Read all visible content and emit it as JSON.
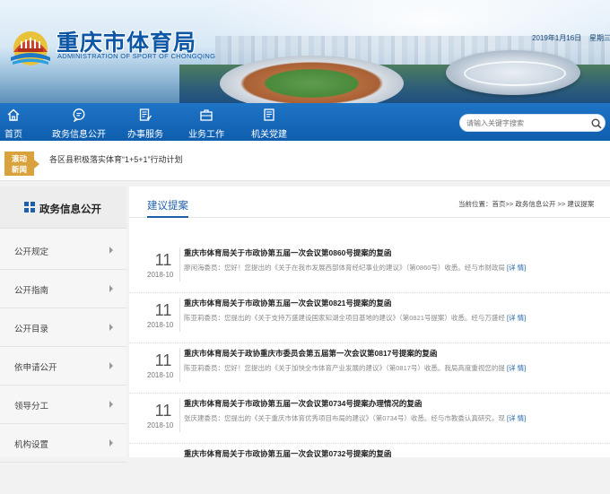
{
  "header": {
    "title": "重庆市体育局",
    "subtitle": "ADMINISTRATION OF SPORT OF CHONGQING",
    "date": "2019年1月16日",
    "weekday": "星期三"
  },
  "nav": {
    "items": [
      {
        "label": "首页",
        "icon": "home-icon"
      },
      {
        "label": "政务信息公开",
        "icon": "chat-bubble-icon"
      },
      {
        "label": "办事服务",
        "icon": "checklist-icon"
      },
      {
        "label": "业务工作",
        "icon": "briefcase-icon"
      },
      {
        "label": "机关党建",
        "icon": "document-icon"
      }
    ],
    "search_placeholder": "请输入关键字搜索"
  },
  "ticker": {
    "badge_line1": "滚动",
    "badge_line2": "新闻",
    "text": "各区县积极落实体育“1+5+1”行动计划"
  },
  "sidebar": {
    "title": "政务信息公开",
    "items": [
      {
        "label": "公开规定"
      },
      {
        "label": "公开指南"
      },
      {
        "label": "公开目录"
      },
      {
        "label": "依申请公开"
      },
      {
        "label": "领导分工"
      },
      {
        "label": "机构设置"
      }
    ]
  },
  "main": {
    "title": "建议提案",
    "breadcrumb": {
      "prefix": "当前位置：",
      "home": "首页",
      "sep": ">>",
      "section": "政务信息公开",
      "current": "建议提案"
    },
    "more_label": "[详 情]",
    "items": [
      {
        "day": "11",
        "month": "2018-10",
        "title": "重庆市体育局关于市政协第五届一次会议第0860号提案的复函",
        "summary": "廖闲海委员：您好！您提出的《关于在我市发展西部体育经纪事业的建议》（第0860号）收悉。经与市财政局"
      },
      {
        "day": "11",
        "month": "2018-10",
        "title": "重庆市体育局关于市政协第五届一次会议第0821号提案的复函",
        "summary": "陈亚莉委员：您提出的《关于支持万盛建设国家知湖全项目基地的建议》（第0821号提案）收悉。经与万盛经"
      },
      {
        "day": "11",
        "month": "2018-10",
        "title": "重庆市体育局关于政协重庆市委员会第五届第一次会议第0817号提案的复函",
        "summary": "陈亚莉委员：您好！您提出的《关于加快全市体育产业发展的建议》（第0817号）收悉。我局高度重视您的提"
      },
      {
        "day": "11",
        "month": "2018-10",
        "title": "重庆市体育局关于市政协第五届一次会议第0734号提案办理情况的复函",
        "summary": "张庆建委员：您提出的《关于重庆市体育优秀项目布局的建议》（第0734号）收悉。经与市教委认真研究，现"
      },
      {
        "day": "",
        "month": "",
        "title": "重庆市体育局关于市政协第五届一次会议第0732号提案的复函",
        "summary": ""
      }
    ]
  },
  "colors": {
    "brand_blue": "#0f5eae",
    "title_blue": "#1d5fa8",
    "badge_gold": "#d9a23c"
  }
}
